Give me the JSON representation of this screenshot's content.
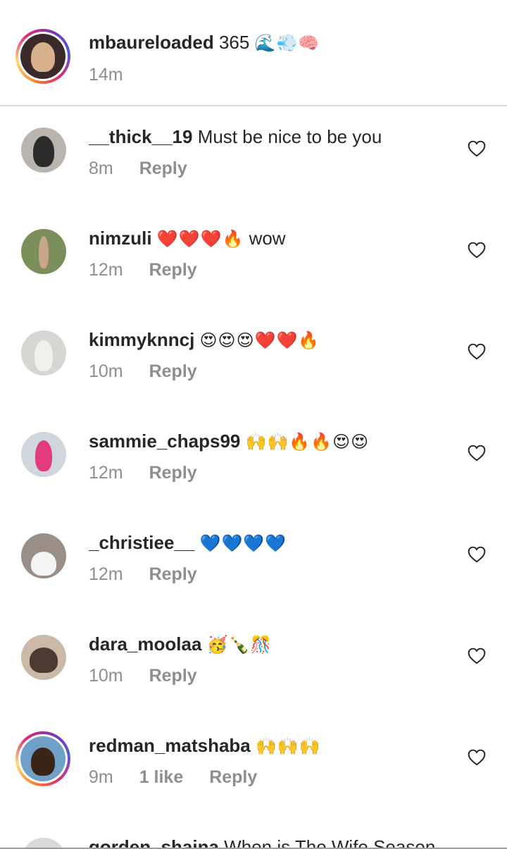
{
  "caption": {
    "username": "mbaureloaded",
    "text": "365",
    "emojis": "🌊💨🧠",
    "time": "14m",
    "avatar_colors": [
      "#3b2a2a",
      "#d8b08c"
    ]
  },
  "comments": [
    {
      "username": "__thick__19",
      "text": "Must be nice to be you",
      "emojis": "",
      "time": "8m",
      "likes": "",
      "reply": "Reply",
      "avatar_colors": [
        "#b9b4ae",
        "#2b2b2b"
      ]
    },
    {
      "username": "nimzuli",
      "text": "wow",
      "emojis": "❤️❤️❤️🔥",
      "time": "12m",
      "likes": "",
      "reply": "Reply",
      "avatar_colors": [
        "#7a8f5a",
        "#c9a58a"
      ]
    },
    {
      "username": "kimmyknncj",
      "text": "",
      "emojis": "😍😍😍❤️❤️🔥",
      "time": "10m",
      "likes": "",
      "reply": "Reply",
      "avatar_colors": [
        "#d8d6d2",
        "#f2f0ec"
      ]
    },
    {
      "username": "sammie_chaps99",
      "text": "",
      "emojis": "🙌🙌🔥🔥😍😍",
      "time": "12m",
      "likes": "",
      "reply": "Reply",
      "avatar_colors": [
        "#cfd6de",
        "#e23a7a"
      ]
    },
    {
      "username": "_christiee__",
      "text": "",
      "emojis": "💙💙💙💙",
      "time": "12m",
      "likes": "",
      "reply": "Reply",
      "avatar_colors": [
        "#9a8f86",
        "#f4f4f4"
      ]
    },
    {
      "username": "dara_moolaa",
      "text": "",
      "emojis": "🥳🍾🎊",
      "time": "10m",
      "likes": "",
      "reply": "Reply",
      "avatar_colors": [
        "#c9b9a6",
        "#4a3a30"
      ]
    },
    {
      "username": "redman_matshaba",
      "text": "",
      "emojis": "🙌🙌🙌",
      "time": "9m",
      "likes": "1 like",
      "reply": "Reply",
      "avatar_colors": [
        "#6fa0c8",
        "#3a2418"
      ]
    },
    {
      "username": "gorden_shaina",
      "text": "When is The Wife Season",
      "emojis": "",
      "time": "",
      "likes": "",
      "reply": "",
      "avatar_colors": [
        "#d9d9d9",
        "#3a2a22"
      ]
    }
  ],
  "colors": {
    "text_primary": "#262626",
    "text_secondary": "#8e8e8e",
    "divider": "#dbdbdb",
    "story_ring": [
      "#f58529",
      "#dd2a7b",
      "#8134af",
      "#515bd4"
    ]
  },
  "icons": {
    "like": "heart-outline-icon"
  }
}
